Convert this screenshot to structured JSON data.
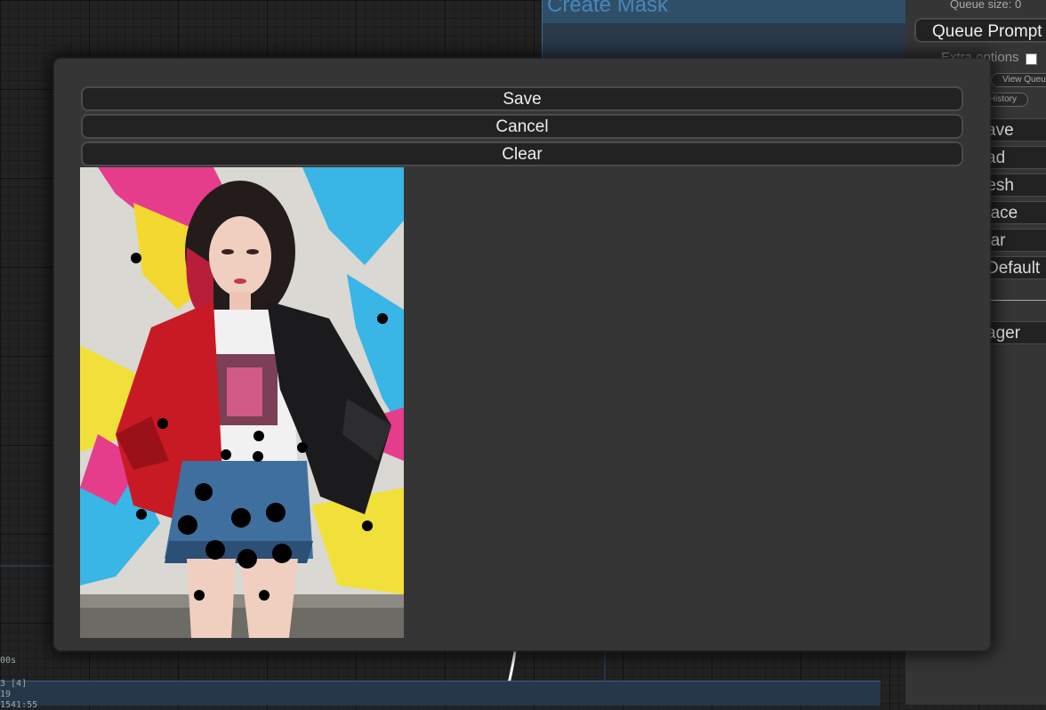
{
  "background_node": {
    "title": "Create Mask"
  },
  "background_text": {
    "line1": "00s",
    "line2": "3 [4]",
    "line3": "19",
    "line4": "1541:55"
  },
  "menu": {
    "queue_size": "Queue size: 0",
    "queue_prompt": "Queue Prompt",
    "extra_options": "Extra options",
    "extra_options_checked": false,
    "view_queue": "View Queue",
    "view_history": "History",
    "buttons": [
      "ave",
      "ad",
      "resh",
      "pace",
      "ear",
      "Default",
      "",
      "ager"
    ]
  },
  "dialog": {
    "save_label": "Save",
    "cancel_label": "Cancel",
    "clear_label": "Clear",
    "canvas_image": "illustration of a girl in a red and black leather jacket, white t-shirt and denim shorts in front of a paint-splashed wall",
    "mask_brush_color": "#000000"
  }
}
